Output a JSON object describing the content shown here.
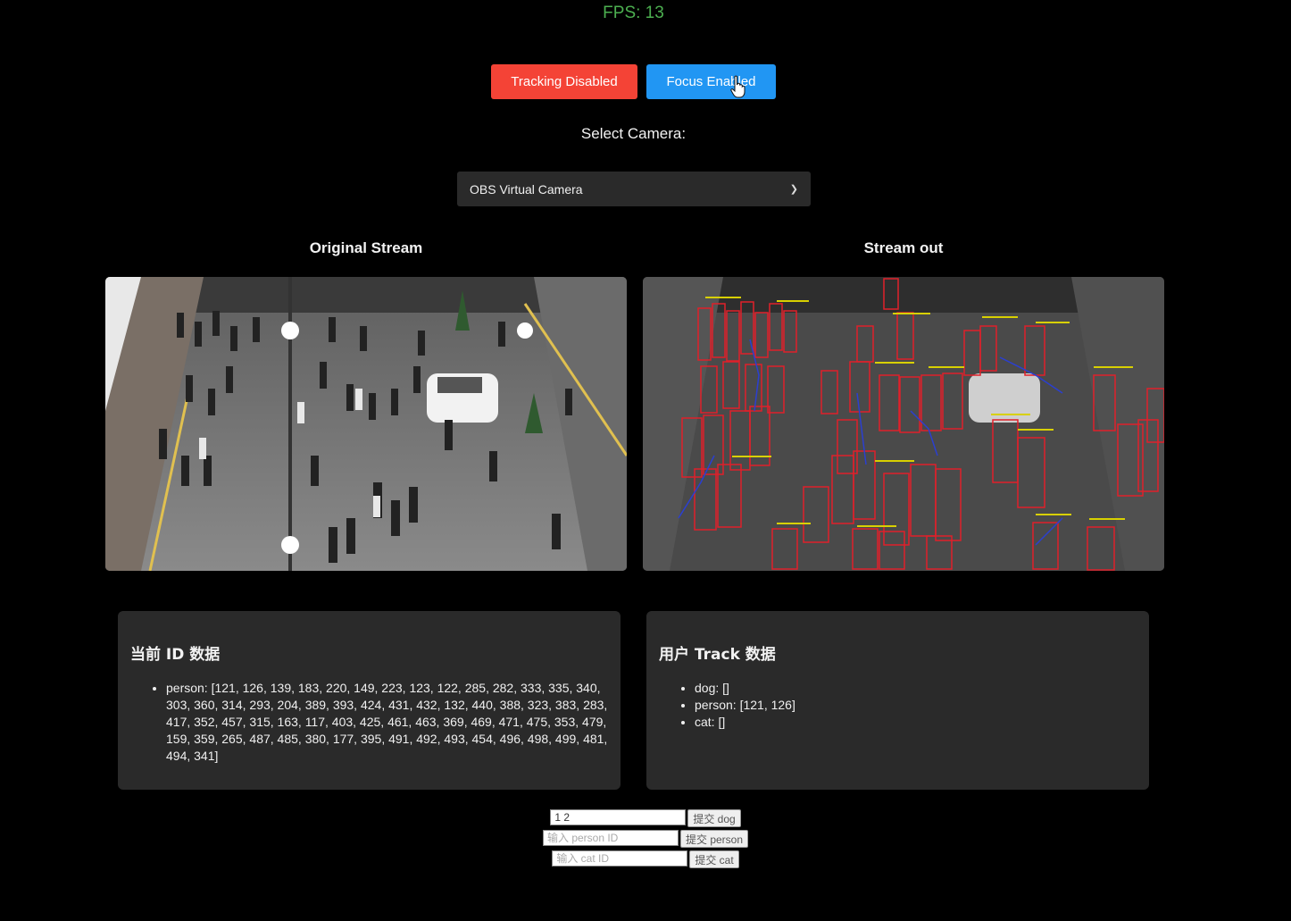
{
  "fps_text": "FPS: 13",
  "buttons": {
    "tracking": "Tracking Disabled",
    "focus": "Focus Enabled"
  },
  "camera": {
    "label": "Select Camera:",
    "selected": "OBS Virtual Camera"
  },
  "streams": {
    "original_title": "Original Stream",
    "out_title": "Stream out"
  },
  "panels": {
    "ids": {
      "title": "当前 ID 数据",
      "items": [
        "person: [121, 126, 139, 183, 220, 149, 223, 123, 122, 285, 282, 333, 335, 340, 303, 360, 314, 293, 204, 389, 393, 424, 431, 432, 132, 440, 388, 323, 383, 283, 417, 352, 457, 315, 163, 117, 403, 425, 461, 463, 369, 469, 471, 475, 353, 479, 159, 359, 265, 487, 485, 380, 177, 395, 491, 492, 493, 454, 496, 498, 499, 481, 494, 341]"
      ]
    },
    "track": {
      "title": "用户 Track 数据",
      "items": [
        "dog: []",
        "person: [121, 126]",
        "cat: []"
      ]
    }
  },
  "forms": {
    "dog": {
      "value": "1 2",
      "placeholder": "",
      "button": "提交 dog"
    },
    "person": {
      "value": "",
      "placeholder": "输入 person ID",
      "button": "提交 person"
    },
    "cat": {
      "value": "",
      "placeholder": "输入 cat ID",
      "button": "提交 cat"
    }
  },
  "colors": {
    "fps": "#4caf50",
    "tracking_button": "#f44336",
    "focus_button": "#2196f3",
    "panel_bg": "#2a2a2a",
    "detection_box": "#e0202a"
  },
  "icons": {
    "cursor": "hand-pointer-icon",
    "select": "chevron-down-icon"
  }
}
